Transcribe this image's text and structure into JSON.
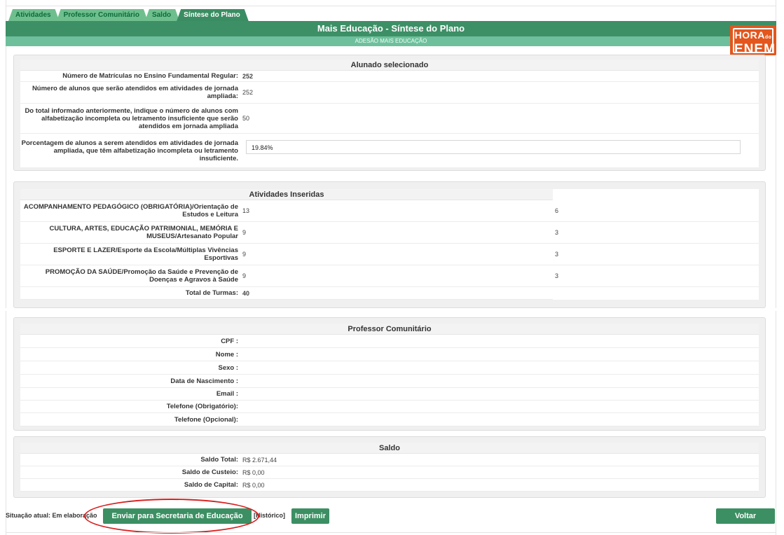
{
  "tabs": [
    {
      "label": "Atividades"
    },
    {
      "label": "Professor Comunitário"
    },
    {
      "label": "Saldo"
    },
    {
      "label": "Síntese do Plano"
    }
  ],
  "header": {
    "title": "Mais Educação - Síntese do Plano",
    "subtitle": "ADESÃO MAIS EDUCAÇÃO",
    "logo_line1": "HORA",
    "logo_small": "do",
    "logo_line2": "ENEM",
    "brand_color": "#3d8f66",
    "logo_color": "#e3561d"
  },
  "alunado": {
    "title": "Alunado selecionado",
    "rows": [
      {
        "label": "Número de Matrículas no Ensino Fundamental Regular:",
        "value": "252"
      },
      {
        "label": "Número de alunos que serão atendidos em atividades de jornada ampliada:",
        "value": "252"
      },
      {
        "label": "Do total informado anteriormente, indique o número de alunos com alfabetização incompleta ou letramento insuficiente que serão atendidos em jornada ampliada",
        "value": "50"
      }
    ],
    "pct_label": "Porcentagem de alunos a serem atendidos em atividades de jornada ampliada, que têm alfabetização incompleta ou letramento insuficiente.",
    "pct_value": "19.84%"
  },
  "atividades": {
    "title": "Atividades Inseridas",
    "rows": [
      {
        "label": "ACOMPANHAMENTO PEDAGÓGICO (OBRIGATÓRIA)/Orientação de Estudos e Leitura",
        "value": "13",
        "value2": "6"
      },
      {
        "label": "CULTURA, ARTES, EDUCAÇÃO PATRIMONIAL, MEMÓRIA E MUSEUS/Artesanato Popular",
        "value": "9",
        "value2": "3"
      },
      {
        "label": "ESPORTE E LAZER/Esporte da Escola/Múltiplas Vivências Esportivas",
        "value": "9",
        "value2": "3"
      },
      {
        "label": "PROMOÇÃO DA SAÚDE/Promoção da Saúde e Prevenção de Doenças e Agravos à Saúde",
        "value": "9",
        "value2": "3"
      }
    ],
    "total_label": "Total de Turmas:",
    "total_value": "40"
  },
  "professor": {
    "title": "Professor Comunitário",
    "rows": [
      {
        "label": "CPF :"
      },
      {
        "label": "Nome :"
      },
      {
        "label": "Sexo :"
      },
      {
        "label": "Data de Nascimento :"
      },
      {
        "label": "Email :"
      },
      {
        "label": "Telefone (Obrigatório):"
      },
      {
        "label": "Telefone (Opcional):"
      }
    ]
  },
  "saldo": {
    "title": "Saldo",
    "rows": [
      {
        "label": "Saldo Total:",
        "value": "R$ 2.671,44"
      },
      {
        "label": "Saldo de Custeio:",
        "value": "R$ 0,00"
      },
      {
        "label": "Saldo de Capital:",
        "value": "R$ 0,00"
      }
    ]
  },
  "footer": {
    "status": "Situação atual: Em elaboração",
    "send_button": "Enviar para Secretaria de Educação",
    "history": "[Histórico]",
    "print_button": "Imprimir",
    "back_button": "Voltar"
  }
}
